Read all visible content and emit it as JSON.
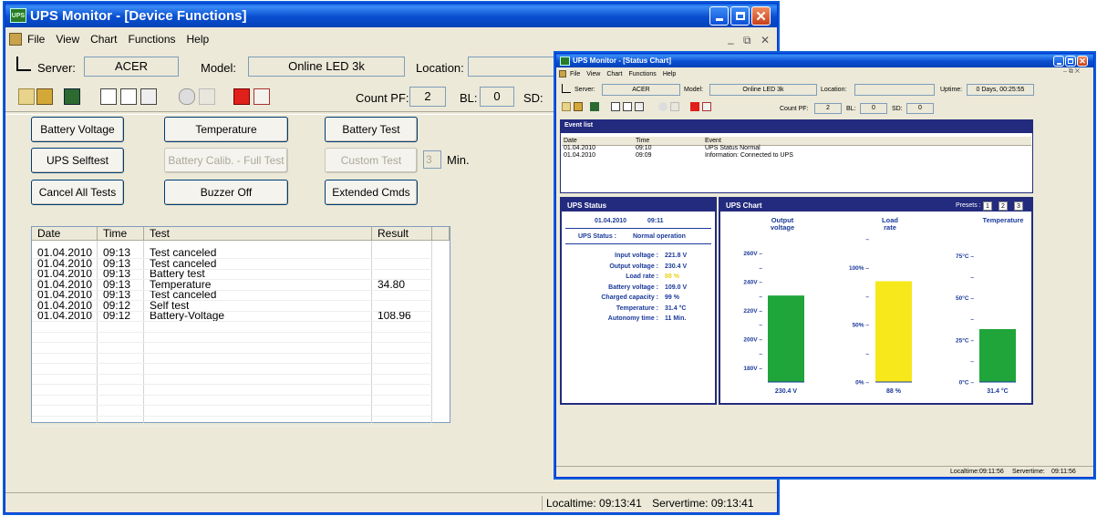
{
  "main": {
    "title": "UPS Monitor - [Device Functions]",
    "app_icon": "UPS",
    "menu": [
      "File",
      "View",
      "Chart",
      "Functions",
      "Help"
    ],
    "server_label": "Server:",
    "server": "ACER",
    "model_label": "Model:",
    "model": "Online LED 3k",
    "location_label": "Location:",
    "location": "",
    "count_pf_label": "Count PF:",
    "count_pf": "2",
    "bl_label": "BL:",
    "bl": "0",
    "sd_label": "SD:",
    "buttons": {
      "battery_voltage": "Battery Voltage",
      "temperature": "Temperature",
      "battery_test": "Battery Test",
      "ups_selftest": "UPS Selftest",
      "battery_calib": "Battery Calib. - Full Test",
      "custom_test": "Custom Test",
      "custom_minutes": "3",
      "minutes_label": "Min.",
      "cancel_all": "Cancel All Tests",
      "buzzer_off": "Buzzer Off",
      "extended_cmds": "Extended Cmds"
    },
    "log": {
      "columns": [
        "Date",
        "Time",
        "Test",
        "Result"
      ],
      "rows": [
        {
          "date": "01.04.2010",
          "time": "09:13",
          "test": "Test canceled",
          "result": ""
        },
        {
          "date": "01.04.2010",
          "time": "09:13",
          "test": "Test canceled",
          "result": ""
        },
        {
          "date": "01.04.2010",
          "time": "09:13",
          "test": "Battery test",
          "result": ""
        },
        {
          "date": "01.04.2010",
          "time": "09:13",
          "test": "Temperature",
          "result": "34.80"
        },
        {
          "date": "01.04.2010",
          "time": "09:13",
          "test": "Test canceled",
          "result": ""
        },
        {
          "date": "01.04.2010",
          "time": "09:12",
          "test": "Self test",
          "result": ""
        },
        {
          "date": "01.04.2010",
          "time": "09:12",
          "test": "Battery-Voltage",
          "result": "108.96"
        }
      ]
    },
    "status": {
      "localtime_label": "Localtime:",
      "localtime": "09:13:41",
      "servertime_label": "Servertime:",
      "servertime": "09:13:41"
    }
  },
  "chart_window": {
    "title": "UPS Monitor - [Status Chart]",
    "menu": [
      "File",
      "View",
      "Chart",
      "Functions",
      "Help"
    ],
    "server_label": "Server:",
    "server": "ACER",
    "model_label": "Model:",
    "model": "Online LED 3k",
    "location_label": "Location:",
    "location": "",
    "uptime_label": "Uptime:",
    "uptime": "0 Days, 00:25:55",
    "count_pf_label": "Count PF:",
    "count_pf": "2",
    "bl_label": "BL:",
    "bl": "0",
    "sd_label": "SD:",
    "sd": "0",
    "event_list": {
      "title": "Event list",
      "columns": [
        "Date",
        "Time",
        "Event"
      ],
      "rows": [
        {
          "date": "01.04.2010",
          "time": "09:10",
          "event": "UPS Status Normal"
        },
        {
          "date": "01.04.2010",
          "time": "09:09",
          "event": "Information: Connected to UPS"
        }
      ]
    },
    "ups_status": {
      "title": "UPS Status",
      "date": "01.04.2010",
      "time": "09:11",
      "status_label": "UPS Status :",
      "status": "Normal operation",
      "items": [
        {
          "label": "Input voltage :",
          "value": "221.8 V"
        },
        {
          "label": "Output voltage :",
          "value": "230.4 V"
        },
        {
          "label": "Load rate :",
          "value": "88 %"
        },
        {
          "label": "Battery voltage :",
          "value": "109.0 V"
        },
        {
          "label": "Charged capacity :",
          "value": "99 %"
        },
        {
          "label": "Temperature :",
          "value": "31.4 °C"
        },
        {
          "label": "Autonomy time :",
          "value": "11 Min."
        }
      ]
    },
    "chart_title": "UPS Chart",
    "presets_label": "Presets :",
    "presets": [
      "1",
      "2",
      "3"
    ],
    "status": {
      "localtime_label": "Localtime:",
      "localtime": "09:11:56",
      "servertime_label": "Servertime:",
      "servertime": "09:11:56"
    }
  },
  "colors": {
    "output_bar": "#1fa53a",
    "load_bar": "#f7e81b",
    "temperature_bar": "#1fa53a",
    "load_highlight": "#e8d21a"
  },
  "chart_data": [
    {
      "type": "bar",
      "title": "Output voltage",
      "values": [
        230.4
      ],
      "value_label": "230.4 V",
      "ylim": [
        170,
        270
      ],
      "ticks": [
        {
          "v": 260,
          "label": "260V"
        },
        {
          "v": 250,
          "label": ""
        },
        {
          "v": 240,
          "label": "240V"
        },
        {
          "v": 230,
          "label": ""
        },
        {
          "v": 220,
          "label": "220V"
        },
        {
          "v": 210,
          "label": ""
        },
        {
          "v": 200,
          "label": "200V"
        },
        {
          "v": 190,
          "label": ""
        },
        {
          "v": 180,
          "label": "180V"
        }
      ]
    },
    {
      "type": "bar",
      "title": "Load rate",
      "values": [
        88
      ],
      "value_label": "88 %",
      "ylim": [
        0,
        125
      ],
      "ticks": [
        {
          "v": 125,
          "label": ""
        },
        {
          "v": 100,
          "label": "100%"
        },
        {
          "v": 75,
          "label": ""
        },
        {
          "v": 50,
          "label": "50%"
        },
        {
          "v": 25,
          "label": ""
        },
        {
          "v": 0,
          "label": "0%"
        }
      ]
    },
    {
      "type": "bar",
      "title": "Temperature",
      "values": [
        31.4
      ],
      "value_label": "31.4 °C",
      "ylim": [
        0,
        85
      ],
      "ticks": [
        {
          "v": 75,
          "label": "75°C"
        },
        {
          "v": 62.5,
          "label": ""
        },
        {
          "v": 50,
          "label": "50°C"
        },
        {
          "v": 37.5,
          "label": ""
        },
        {
          "v": 25,
          "label": "25°C"
        },
        {
          "v": 12.5,
          "label": ""
        },
        {
          "v": 0,
          "label": "0°C"
        }
      ]
    }
  ]
}
